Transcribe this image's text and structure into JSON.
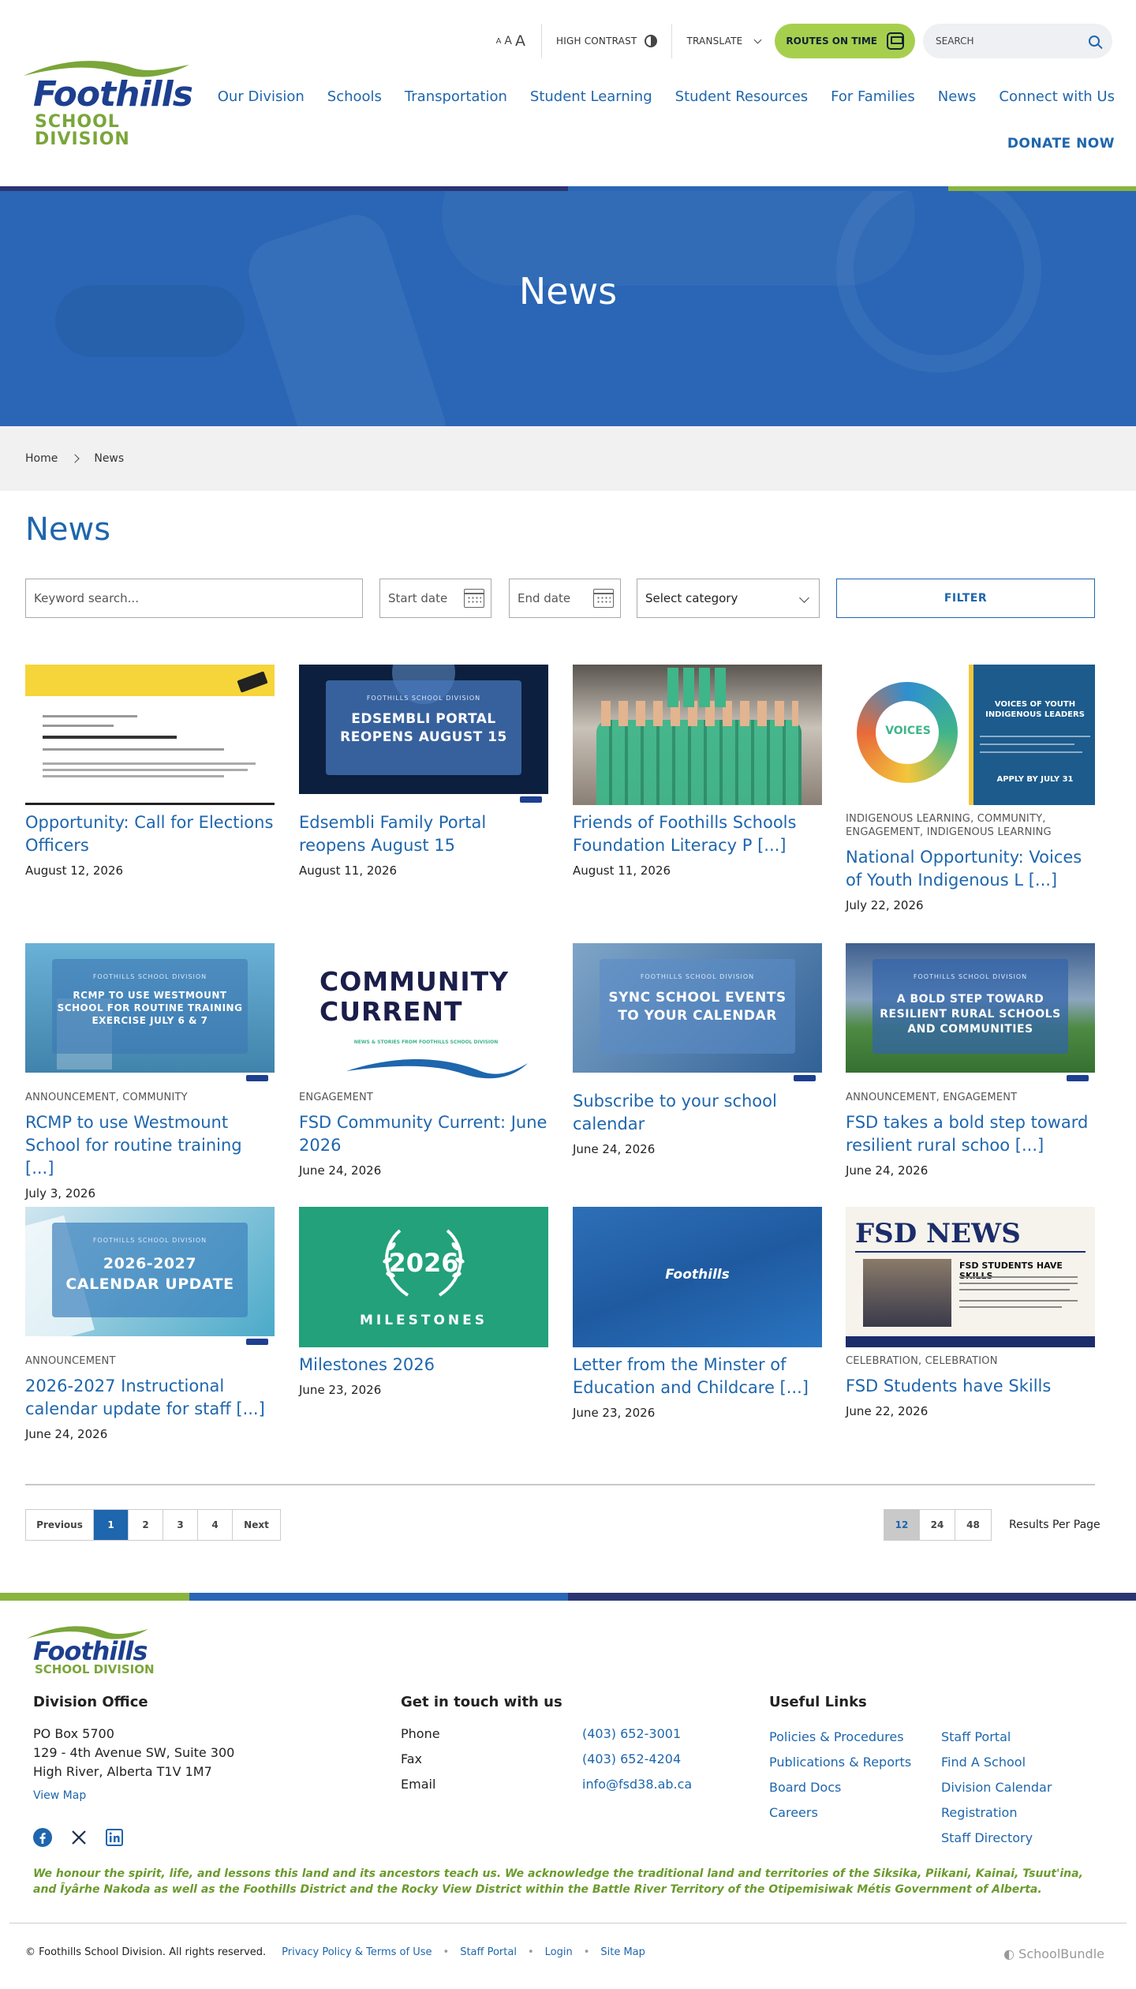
{
  "header": {
    "logo_name": "Foothills",
    "logo_sub": "SCHOOL DIVISION",
    "font_sizes": [
      "A",
      "A",
      "A"
    ],
    "high_contrast": "HIGH CONTRAST",
    "translate": "TRANSLATE",
    "routes": "ROUTES ON TIME",
    "search_placeholder": "SEARCH",
    "nav": [
      "Our Division",
      "Schools",
      "Transportation",
      "Student Learning",
      "Student Resources",
      "For Families",
      "News",
      "Connect with Us"
    ],
    "donate": "DONATE NOW"
  },
  "hero": {
    "title": "News"
  },
  "breadcrumb": {
    "home": "Home",
    "current": "News"
  },
  "page": {
    "title": "News"
  },
  "filters": {
    "keyword_placeholder": "Keyword search...",
    "start_placeholder": "Start date",
    "end_placeholder": "End date",
    "category": "Select category",
    "button": "FILTER"
  },
  "cards": [
    {
      "category": "",
      "title": "Opportunity: Call for Elections Officers",
      "date": "August 12, 2026",
      "thumb_text": "",
      "thumb_kicker": ""
    },
    {
      "category": "",
      "title": "Edsembli Family Portal reopens August 15",
      "date": "August 11, 2026",
      "thumb_text": "EDSEMBLI PORTAL REOPENS AUGUST 15",
      "thumb_kicker": "FOOTHILLS SCHOOL DIVISION"
    },
    {
      "category": "",
      "title": "Friends of Foothills Schools Foundation Literacy P [...]",
      "date": "August 11, 2026",
      "thumb_text": "",
      "thumb_kicker": ""
    },
    {
      "category": "INDIGENOUS LEARNING, COMMUNITY, ENGAGEMENT, INDIGENOUS LEARNING",
      "title": "National Opportunity: Voices of Youth Indigenous L [...]",
      "date": "July 22, 2026",
      "thumb_text": "VOICES OF YOUTH INDIGENOUS LEADERS",
      "thumb_kicker": "APPLY BY JULY 31"
    },
    {
      "category": "ANNOUNCEMENT, COMMUNITY",
      "title": "RCMP to use Westmount School for routine training [...]",
      "date": "July 3, 2026",
      "thumb_text": "RCMP TO USE WESTMOUNT SCHOOL FOR ROUTINE TRAINING EXERCISE JULY 6 & 7",
      "thumb_kicker": "FOOTHILLS SCHOOL DIVISION"
    },
    {
      "category": "ENGAGEMENT",
      "title": "FSD Community Current: June 2026",
      "date": "June 24, 2026",
      "thumb_text": "COMMUNITY CURRENT",
      "thumb_kicker": "NEWS & STORIES FROM FOOTHILLS SCHOOL DIVISION"
    },
    {
      "category": "",
      "title": "Subscribe to your school calendar",
      "date": "June 24, 2026",
      "thumb_text": "SYNC SCHOOL EVENTS TO YOUR CALENDAR",
      "thumb_kicker": "FOOTHILLS SCHOOL DIVISION"
    },
    {
      "category": "ANNOUNCEMENT, ENGAGEMENT",
      "title": "FSD takes a bold step toward resilient rural schoo [...]",
      "date": "June 24, 2026",
      "thumb_text": "A BOLD STEP TOWARD RESILIENT RURAL SCHOOLS AND COMMUNITIES",
      "thumb_kicker": "FOOTHILLS SCHOOL DIVISION"
    },
    {
      "category": "ANNOUNCEMENT",
      "title": "2026-2027 Instructional calendar update for staff [...]",
      "date": "June 24, 2026",
      "thumb_text": "2026-2027 CALENDAR UPDATE",
      "thumb_kicker": "FOOTHILLS SCHOOL DIVISION"
    },
    {
      "category": "",
      "title": "Milestones 2026",
      "date": "June 23, 2026",
      "thumb_text": "2026",
      "thumb_kicker": "MILESTONES"
    },
    {
      "category": "",
      "title": "Letter from the Minster of Education and Childcare [...]",
      "date": "June 23, 2026",
      "thumb_text": "Foothills",
      "thumb_kicker": ""
    },
    {
      "category": "CELEBRATION, CELEBRATION",
      "title": "FSD Students have Skills",
      "date": "June 22, 2026",
      "thumb_text": "FSD NEWS",
      "thumb_kicker": "FSD STUDENTS HAVE SKILLS"
    }
  ],
  "pagination": {
    "previous": "Previous",
    "pages": [
      "1",
      "2",
      "3",
      "4"
    ],
    "next": "Next"
  },
  "per_page": {
    "options": [
      "12",
      "24",
      "48"
    ],
    "label": "Results Per Page"
  },
  "footer": {
    "office_title": "Division Office",
    "address": [
      "PO Box 5700",
      "129 - 4th Avenue SW, Suite 300",
      "High River, Alberta T1V 1M7"
    ],
    "view_map": "View Map",
    "contact_title": "Get in touch with us",
    "contacts": [
      {
        "label": "Phone",
        "value": "(403) 652-3001"
      },
      {
        "label": "Fax",
        "value": "(403) 652-4204"
      },
      {
        "label": "Email",
        "value": "info@fsd38.ab.ca"
      }
    ],
    "links_title": "Useful Links",
    "links_col1": [
      "Policies & Procedures",
      "Publications & Reports",
      "Board Docs",
      "Careers"
    ],
    "links_col2": [
      "Staff Portal",
      "Find A School",
      "Division Calendar",
      "Registration",
      "Staff Directory"
    ],
    "acknowledgement": "We honour the spirit, life, and lessons this land and its ancestors teach us. We acknowledge the traditional land and territories of the Siksika, Piikani, Kainai, Tsuut'ina, and Îyârhe Nakoda as well as the Foothills District and the Rocky View District within the Battle River Territory of the Otipemisiwak Métis Government of Alberta.",
    "copyright": "© Foothills School Division. All rights reserved.",
    "bottom_links": [
      "Privacy Policy & Terms of Use",
      "Staff Portal",
      "Login",
      "Site Map"
    ],
    "brand": "SchoolBundle"
  },
  "colors": {
    "primary": "#1e66ad",
    "navy": "#1d3f8f",
    "green": "#7aa63a",
    "lime": "#a7cf4e",
    "hero": "#2a66b5"
  }
}
